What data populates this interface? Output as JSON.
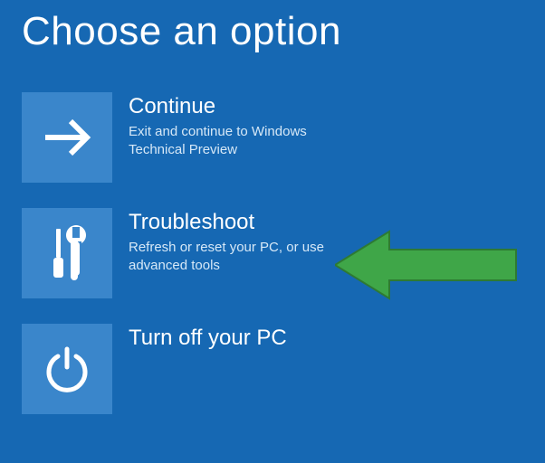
{
  "title": "Choose an option",
  "options": {
    "continue": {
      "title": "Continue",
      "desc": "Exit and continue to Windows Technical Preview"
    },
    "troubleshoot": {
      "title": "Troubleshoot",
      "desc": "Refresh or reset your PC, or use advanced tools"
    },
    "poweroff": {
      "title": "Turn off your PC",
      "desc": ""
    }
  },
  "colors": {
    "bg": "#1668b3",
    "tile": "#3a86cb",
    "arrow": "#3fa648"
  }
}
